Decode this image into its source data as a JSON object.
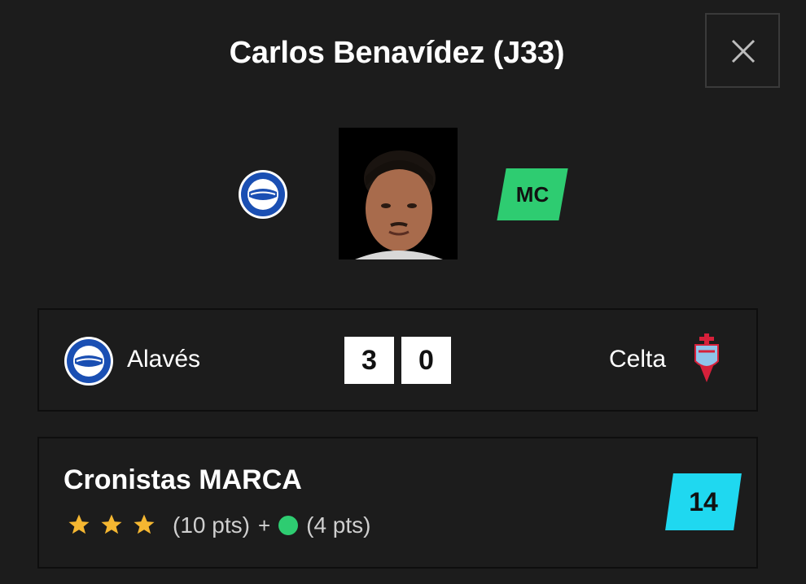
{
  "header": {
    "title": "Carlos Benavídez (J33)",
    "close_icon": "close-icon"
  },
  "player": {
    "team_crest_icon": "alaves-crest-icon",
    "position": "MC",
    "position_color": "#2ecc71"
  },
  "match": {
    "home_team": "Alavés",
    "home_crest_icon": "alaves-crest-icon",
    "home_score": "3",
    "away_score": "0",
    "away_team": "Celta",
    "away_crest_icon": "celta-crest-icon"
  },
  "cronistas": {
    "title": "Cronistas MARCA",
    "stars": 3,
    "stars_pts": "(10 pts)",
    "plus": "+",
    "bonus_pts": "(4 pts)",
    "total": "14",
    "total_color": "#1fd8f0",
    "star_color": "#f5b731",
    "bonus_dot_color": "#2ecc71"
  }
}
